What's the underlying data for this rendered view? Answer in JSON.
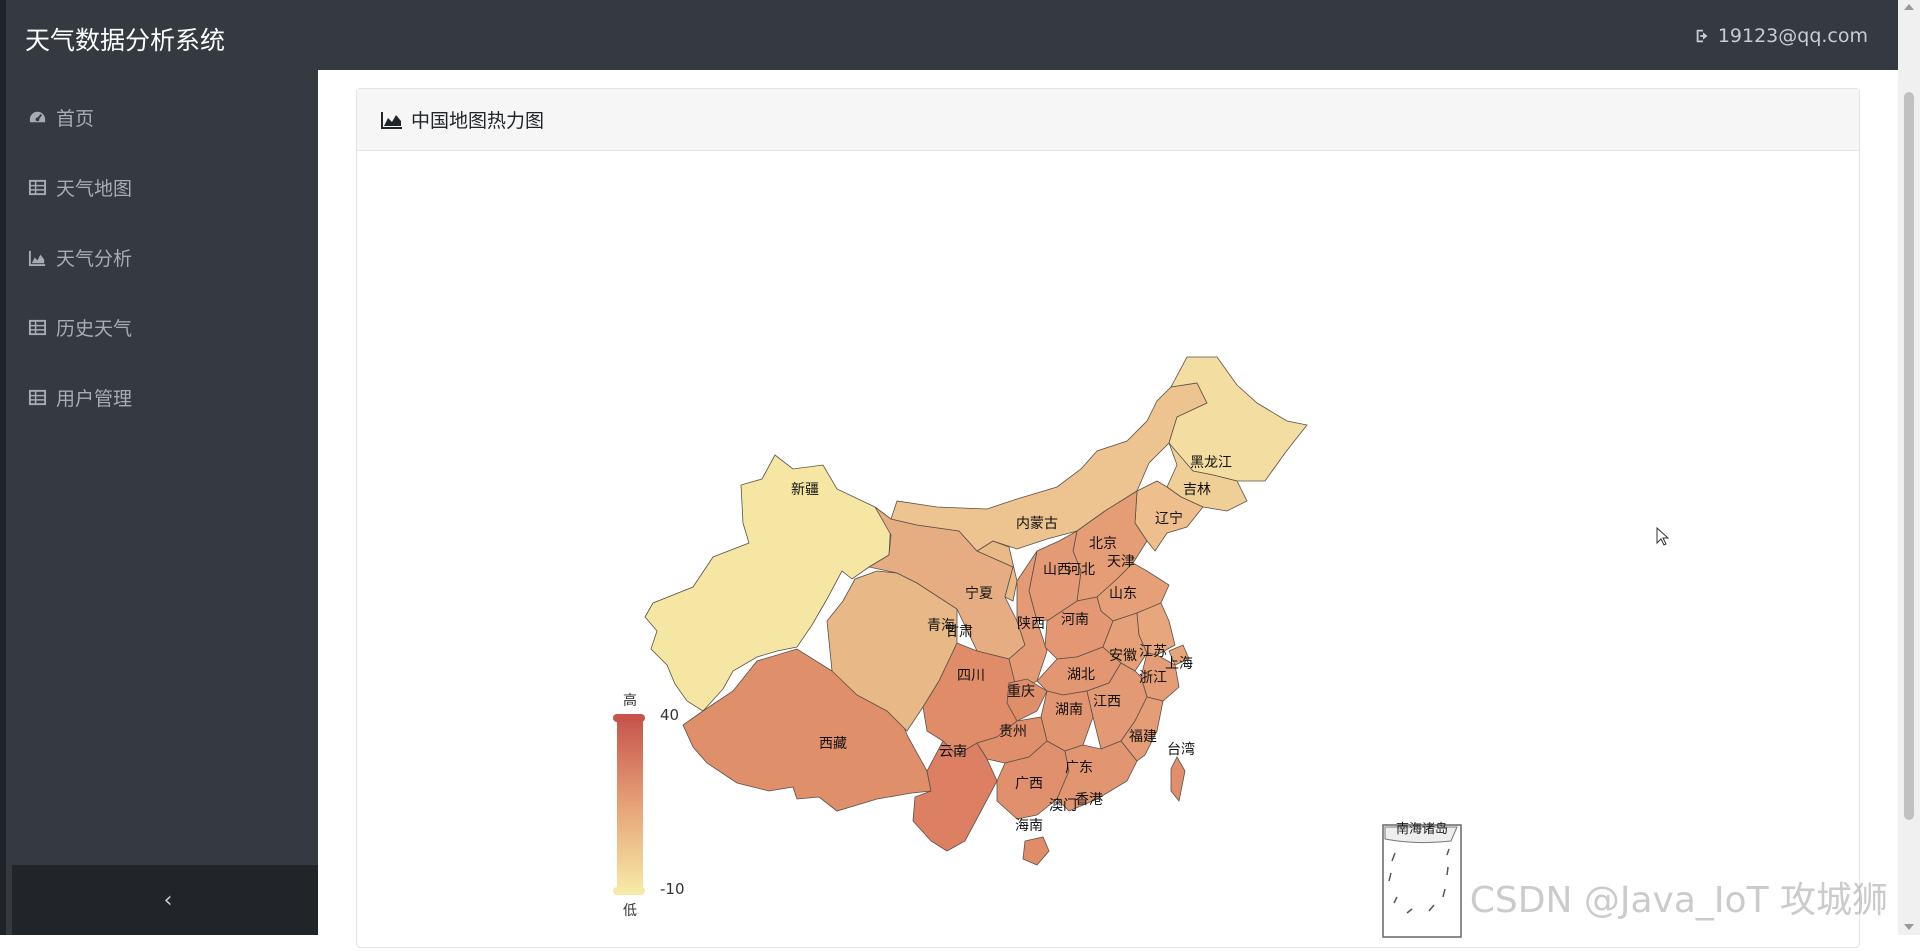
{
  "header": {
    "brand": "天气数据分析系统",
    "user_email": "19123@qq.com",
    "user_icon": "sign-out-icon"
  },
  "sidebar": {
    "items": [
      {
        "label": "首页",
        "icon": "dashboard-icon"
      },
      {
        "label": "天气地图",
        "icon": "table-icon"
      },
      {
        "label": "天气分析",
        "icon": "area-chart-icon"
      },
      {
        "label": "历史天气",
        "icon": "table-icon"
      },
      {
        "label": "用户管理",
        "icon": "table-icon"
      }
    ],
    "collapse_label": "‹"
  },
  "card": {
    "title": "中国地图热力图",
    "icon": "area-chart-icon"
  },
  "chart_data": {
    "type": "heatmap",
    "visual_map": {
      "max": 40,
      "min": -10,
      "max_text": "高",
      "min_text": "低",
      "color_high": "#c6544c",
      "color_low": "#f6e9a6"
    },
    "provinces": [
      "新疆",
      "西藏",
      "青海",
      "甘肃",
      "宁夏",
      "内蒙古",
      "黑龙江",
      "吉林",
      "辽宁",
      "北京",
      "天津",
      "河北",
      "山西",
      "山东",
      "陕西",
      "河南",
      "四川",
      "重庆",
      "湖北",
      "安徽",
      "江苏",
      "上海",
      "浙江",
      "湖南",
      "江西",
      "贵州",
      "云南",
      "广西",
      "广东",
      "福建",
      "台湾",
      "香港",
      "澳门",
      "海南"
    ],
    "inset_label": "南海诸岛"
  },
  "watermark": "CSDN @Java_IoT 攻城狮"
}
